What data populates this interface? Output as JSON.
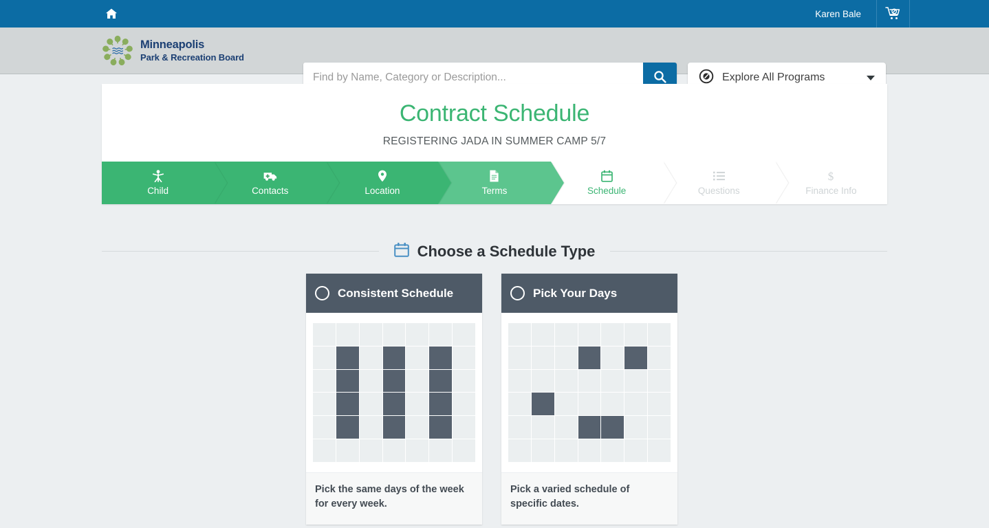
{
  "topbar": {
    "home_icon": "home-icon",
    "user_name": "Karen Bale",
    "cart_icon": "empty-cart-icon"
  },
  "header": {
    "logo": {
      "icon": "minneapolis-park-trees-logo",
      "line1": "Minneapolis",
      "line2": "Park & Recreation Board"
    },
    "search": {
      "placeholder": "Find by Name, Category or Description...",
      "value": "",
      "button_icon": "search-icon"
    },
    "explore": {
      "icon": "compass-icon",
      "label": "Explore All Programs",
      "caret_icon": "chevron-down-icon"
    }
  },
  "page": {
    "title": "Contract Schedule",
    "subtitle": "REGISTERING JADA IN SUMMER CAMP 5/7"
  },
  "steps": [
    {
      "label": "Child",
      "icon": "child-icon",
      "state": "done"
    },
    {
      "label": "Contacts",
      "icon": "ambulance-icon",
      "state": "done"
    },
    {
      "label": "Location",
      "icon": "map-pin-icon",
      "state": "done"
    },
    {
      "label": "Terms",
      "icon": "document-icon",
      "state": "current-edge"
    },
    {
      "label": "Schedule",
      "icon": "calendar-icon",
      "state": "active"
    },
    {
      "label": "Questions",
      "icon": "list-icon",
      "state": "future"
    },
    {
      "label": "Finance Info",
      "icon": "dollar-icon",
      "state": "future"
    }
  ],
  "section": {
    "icon": "calendar-icon",
    "title": "Choose a Schedule Type"
  },
  "schedule_types": [
    {
      "title": "Consistent Schedule",
      "selected": false,
      "description": "Pick the same days of the week for every week.",
      "grid": {
        "cols": 7,
        "rows": 6,
        "on_cells": [
          [
            1,
            1
          ],
          [
            1,
            2
          ],
          [
            1,
            3
          ],
          [
            1,
            4
          ],
          [
            3,
            1
          ],
          [
            3,
            2
          ],
          [
            3,
            3
          ],
          [
            3,
            4
          ],
          [
            5,
            1
          ],
          [
            5,
            2
          ],
          [
            5,
            3
          ],
          [
            5,
            4
          ]
        ]
      }
    },
    {
      "title": "Pick Your Days",
      "selected": false,
      "description": "Pick a varied schedule of specific dates.",
      "grid": {
        "cols": 7,
        "rows": 6,
        "on_cells": [
          [
            3,
            1
          ],
          [
            5,
            1
          ],
          [
            1,
            3
          ],
          [
            3,
            4
          ],
          [
            4,
            4
          ]
        ]
      }
    }
  ],
  "colors": {
    "topbar_blue": "#0c6ca4",
    "header_gray": "#d2d6d7",
    "brand_navy": "#1b3f73",
    "accent_green": "#3bb573",
    "step_light_green": "#5cc58e",
    "card_header_slate": "#4e5a67",
    "cell_on": "#56616e",
    "cell_off": "#ebeff0",
    "page_bg": "#eceff1"
  }
}
